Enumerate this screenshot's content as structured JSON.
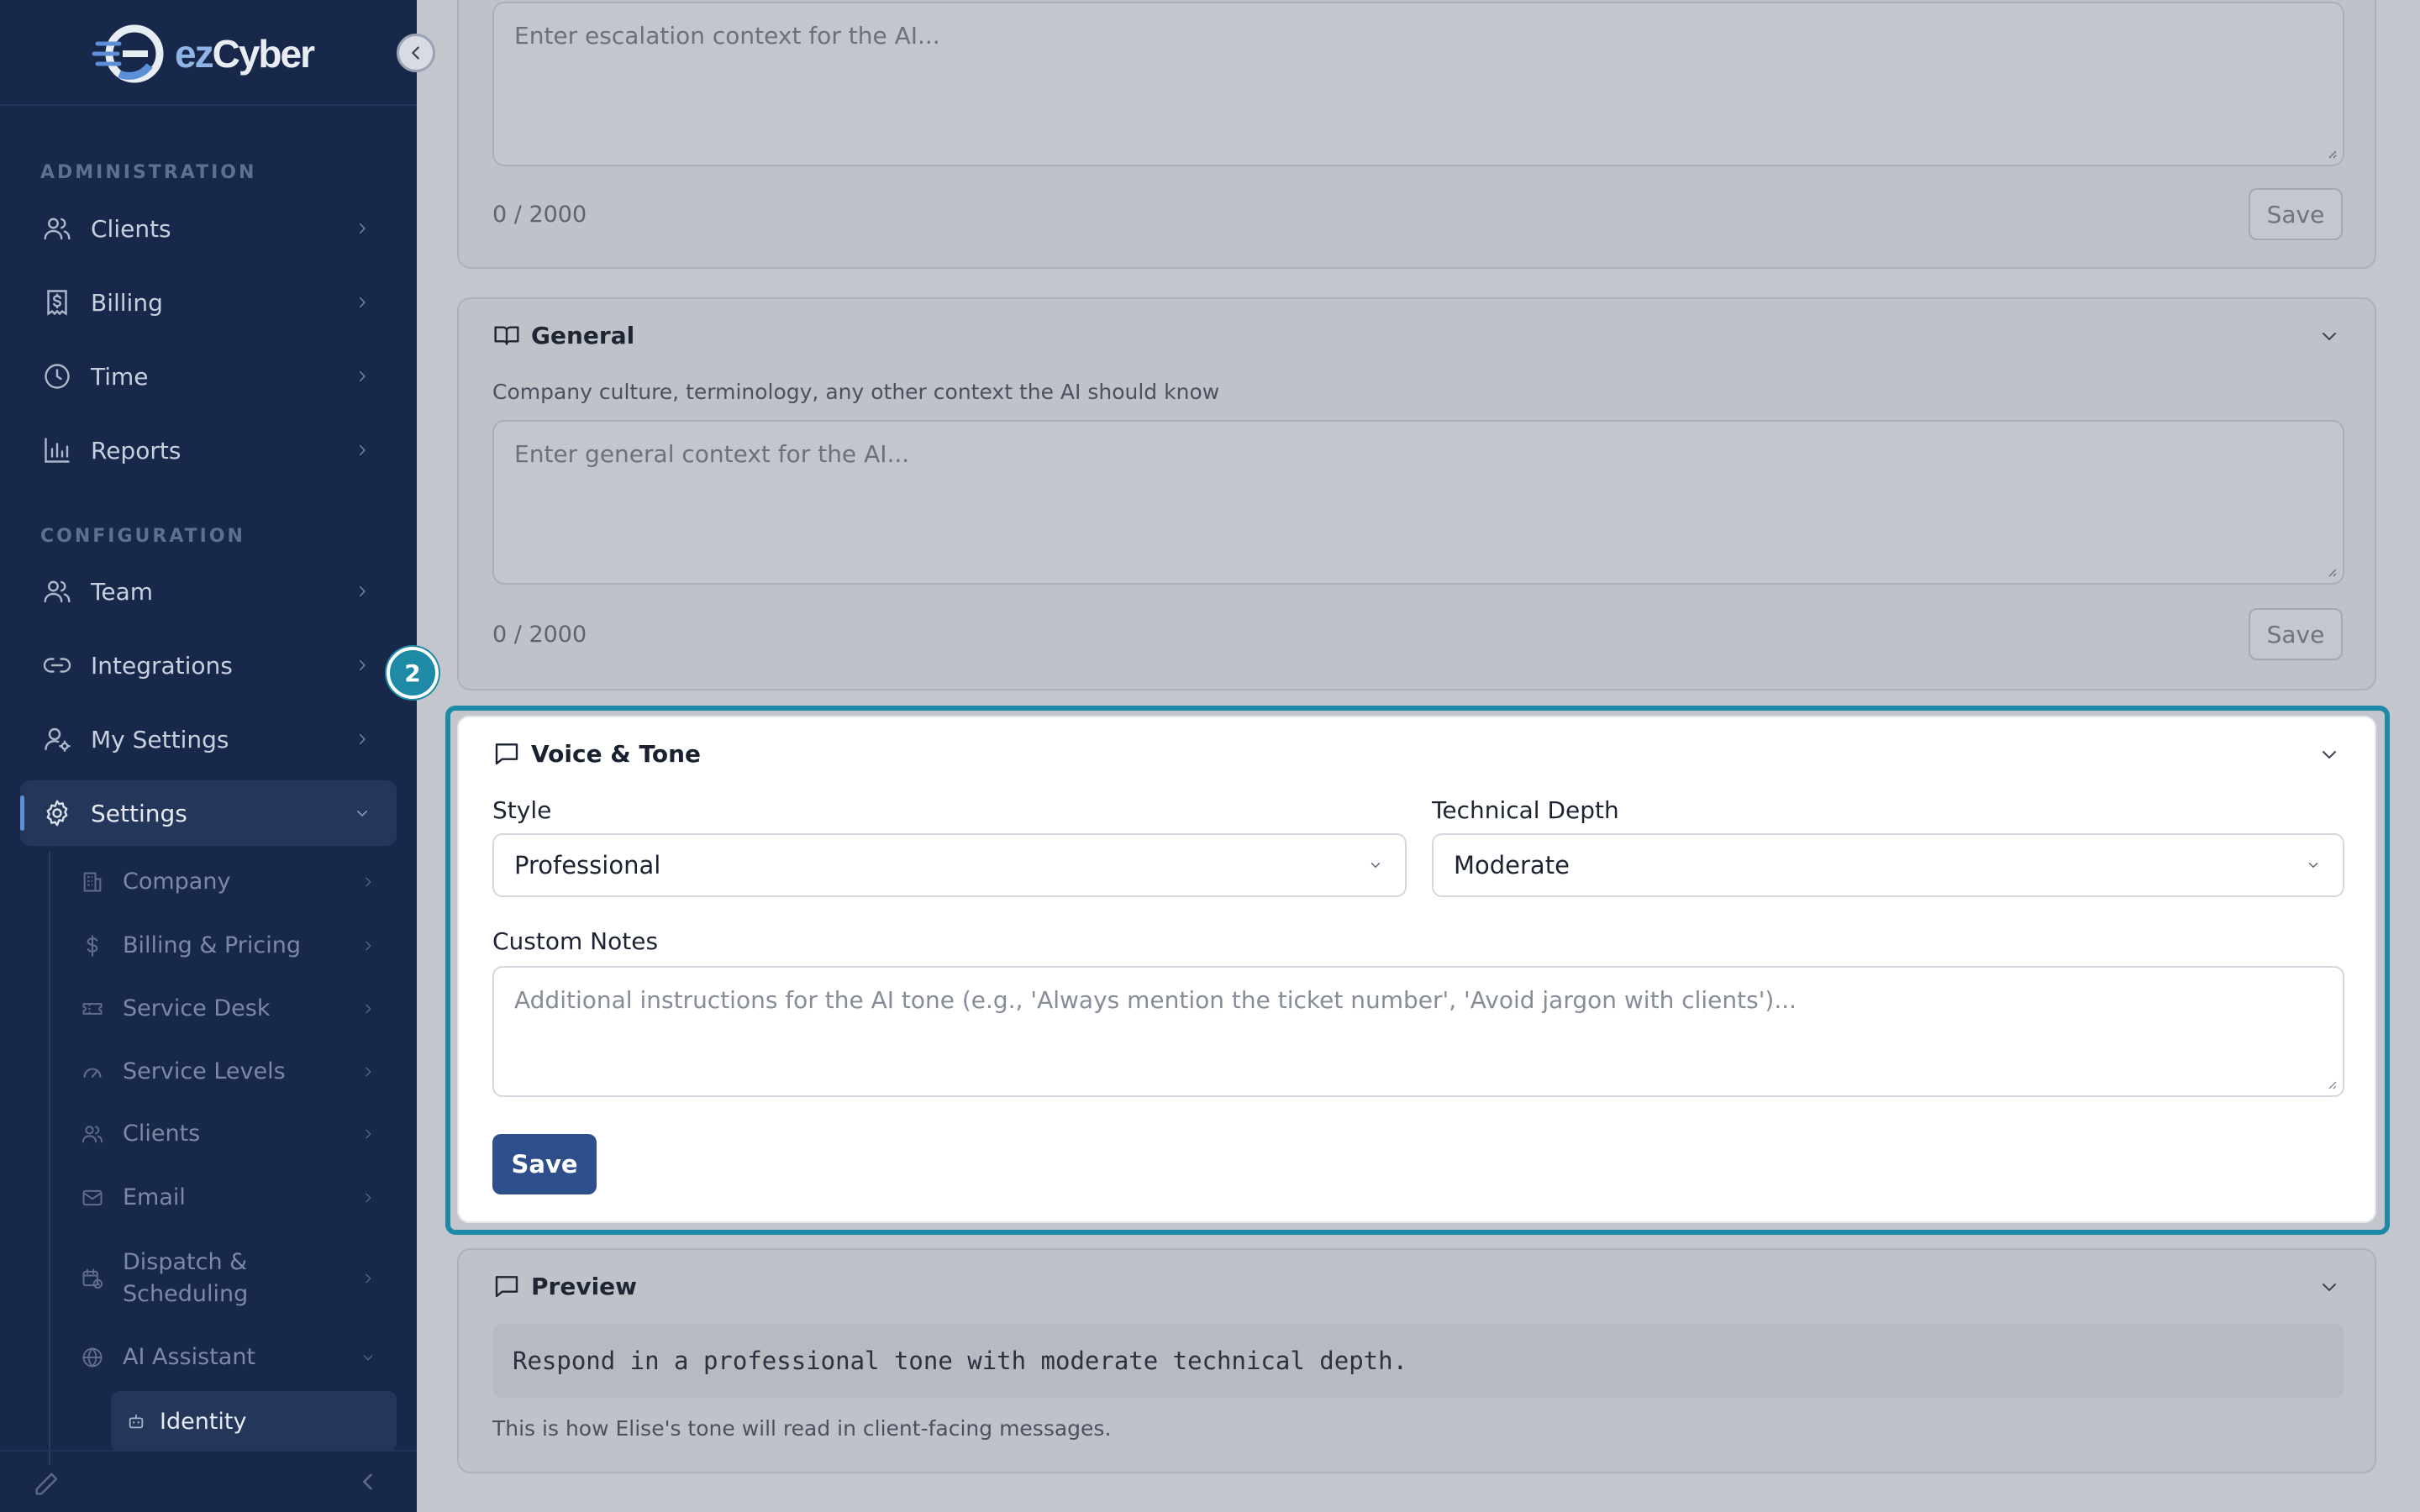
{
  "brand": {
    "logo_prefix": "ez",
    "logo_suffix": "Cyber"
  },
  "sidebar": {
    "sections": [
      {
        "label": "ADMINISTRATION"
      },
      {
        "label": "CONFIGURATION"
      }
    ],
    "admin_items": [
      {
        "label": "Clients",
        "icon": "users-icon"
      },
      {
        "label": "Billing",
        "icon": "receipt-dollar-icon"
      },
      {
        "label": "Time",
        "icon": "clock-icon"
      },
      {
        "label": "Reports",
        "icon": "bar-chart-icon"
      }
    ],
    "config_items": [
      {
        "label": "Team",
        "icon": "users-icon"
      },
      {
        "label": "Integrations",
        "icon": "link-icon"
      },
      {
        "label": "My Settings",
        "icon": "user-cog-icon"
      },
      {
        "label": "Settings",
        "icon": "gear-icon",
        "active": true
      }
    ],
    "settings_children": [
      {
        "label": "Company"
      },
      {
        "label": "Billing & Pricing"
      },
      {
        "label": "Service Desk"
      },
      {
        "label": "Service Levels"
      },
      {
        "label": "Clients"
      },
      {
        "label": "Email"
      },
      {
        "label": "Dispatch & Scheduling"
      },
      {
        "label": "AI Assistant"
      }
    ],
    "ai_children": [
      {
        "label": "Identity",
        "active": true
      }
    ]
  },
  "escalation": {
    "placeholder": "Enter escalation context for the AI...",
    "counter": "0 / 2000",
    "save_label": "Save"
  },
  "general": {
    "title": "General",
    "description": "Company culture, terminology, any other context the AI should know",
    "placeholder": "Enter general context for the AI...",
    "counter": "0 / 2000",
    "save_label": "Save"
  },
  "step_badge": "2",
  "voice_tone": {
    "title": "Voice & Tone",
    "style_label": "Style",
    "style_value": "Professional",
    "depth_label": "Technical Depth",
    "depth_value": "Moderate",
    "notes_label": "Custom Notes",
    "notes_placeholder": "Additional instructions for the AI tone (e.g., 'Always mention the ticket number', 'Avoid jargon with clients')...",
    "save_label": "Save"
  },
  "preview": {
    "title": "Preview",
    "text": "Respond in a professional tone with moderate technical depth.",
    "caption": "This is how Elise's tone will read in client-facing messages."
  },
  "colors": {
    "sidebar_bg": "#18284a",
    "accent": "#1f8aa6",
    "primary_button": "#2f4f8c"
  }
}
